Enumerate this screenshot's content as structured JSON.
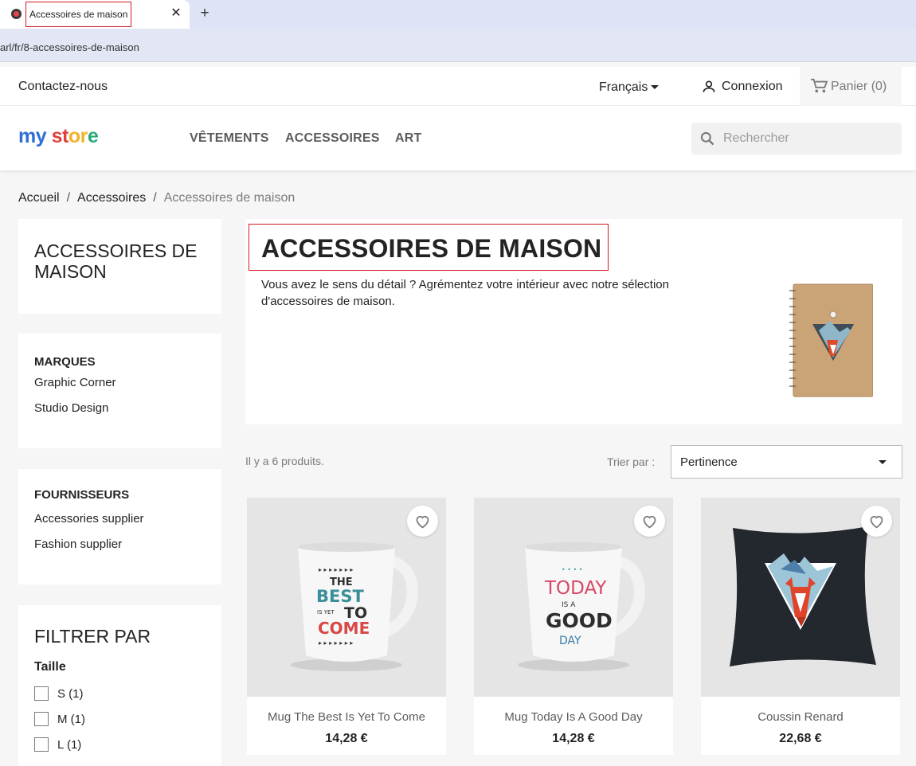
{
  "browser": {
    "tab_title": "Accessoires de maison",
    "tab_close": "✕",
    "new_tab": "+",
    "url": "arl/fr/8-accessoires-de-maison"
  },
  "header": {
    "contact": "Contactez-nous",
    "language": "Français",
    "login": "Connexion",
    "cart": "Panier (0)"
  },
  "logo": {
    "part1": "my",
    "part2": "st",
    "part3": "or",
    "part4": "e"
  },
  "menu": [
    {
      "label": "VÊTEMENTS"
    },
    {
      "label": "ACCESSOIRES"
    },
    {
      "label": "ART"
    }
  ],
  "search": {
    "placeholder": "Rechercher"
  },
  "breadcrumb": {
    "items": [
      "Accueil",
      "Accessoires",
      "Accessoires de maison"
    ],
    "separator": "/"
  },
  "sidebar": {
    "category_title": "ACCESSOIRES DE MAISON",
    "brands": {
      "title": "MARQUES",
      "items": [
        "Graphic Corner",
        "Studio Design"
      ]
    },
    "suppliers": {
      "title": "FOURNISSEURS",
      "items": [
        "Accessories supplier",
        "Fashion supplier"
      ]
    },
    "filters": {
      "title": "FILTRER PAR",
      "group": "Taille",
      "options": [
        "S (1)",
        "M (1)",
        "L (1)"
      ]
    }
  },
  "category": {
    "title": "ACCESSOIRES DE MAISON",
    "description": "Vous avez le sens du détail ? Agrémentez votre intérieur avec notre sélection d'accessoires de maison."
  },
  "listing": {
    "count": "Il y a 6 produits.",
    "sort_label": "Trier par :",
    "sort_value": "Pertinence"
  },
  "products": [
    {
      "name": "Mug The Best Is Yet To Come",
      "price": "14,28 €",
      "art": [
        "THE",
        "BEST",
        "IS YET",
        "TO",
        "COME"
      ]
    },
    {
      "name": "Mug Today Is A Good Day",
      "price": "14,28 €",
      "art": [
        "TODAY",
        "IS A",
        "GOOD",
        "DAY"
      ]
    },
    {
      "name": "Coussin Renard",
      "price": "22,68 €"
    }
  ],
  "colors": {
    "accent_red": "#d11b24",
    "tabbar": "#dfe3f6",
    "page_bg": "#f6f6f6"
  }
}
